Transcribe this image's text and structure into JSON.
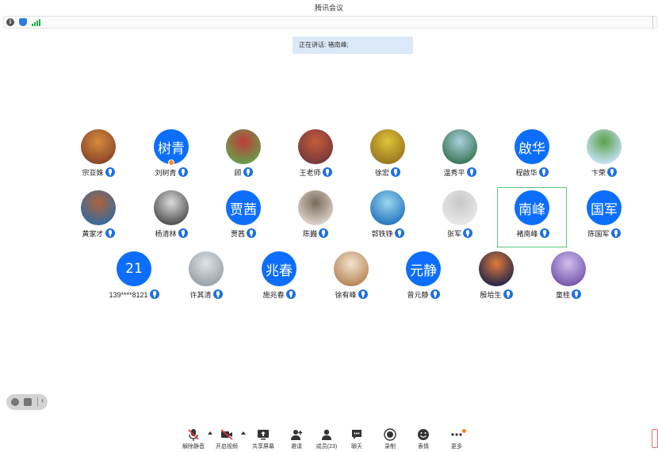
{
  "window": {
    "title": "腾讯会议"
  },
  "speaking": {
    "text": "正在讲话: 褚南峰;"
  },
  "participants": [
    {
      "name": "宗亚姝",
      "avatar_colors": [
        "#8b4a2b",
        "#d98a3a"
      ]
    },
    {
      "name": "刘树青",
      "avatar_text": "树青",
      "host": true
    },
    {
      "name": "顾",
      "avatar_colors": [
        "#6a9a4a",
        "#c33b3b"
      ]
    },
    {
      "name": "王老师",
      "avatar_colors": [
        "#7a3a3a",
        "#c45c3a"
      ]
    },
    {
      "name": "徐宏",
      "avatar_colors": [
        "#9b7a1f",
        "#e0c23a"
      ]
    },
    {
      "name": "温秀平",
      "avatar_colors": [
        "#3e7a5a",
        "#aad0e0"
      ]
    },
    {
      "name": "程啟华",
      "avatar_text": "啟华"
    },
    {
      "name": "卞荣",
      "avatar_colors": [
        "#bfe0ef",
        "#5aa04a"
      ]
    },
    {
      "name": "黄家才",
      "avatar_colors": [
        "#3a6a9a",
        "#b0623a"
      ]
    },
    {
      "name": "杨清林",
      "avatar_colors": [
        "#555555",
        "#dddddd"
      ]
    },
    {
      "name": "贾茜",
      "avatar_text": "贾茜"
    },
    {
      "name": "陈巍",
      "avatar_colors": [
        "#d8cfc6",
        "#7a6a5a"
      ]
    },
    {
      "name": "郭铁铮",
      "avatar_colors": [
        "#2a7ac0",
        "#9ed6f0"
      ]
    },
    {
      "name": "张军",
      "avatar_colors": [
        "#e6e6e6",
        "#c8c8c8"
      ]
    },
    {
      "name": "褚南峰",
      "avatar_text": "南峰",
      "highlight": true
    },
    {
      "name": "陈国军",
      "avatar_text": "国军"
    },
    {
      "name": "139****8121",
      "avatar_text": "21"
    },
    {
      "name": "许其清",
      "avatar_colors": [
        "#9aa3ab",
        "#dfe4e8"
      ]
    },
    {
      "name": "施兆春",
      "avatar_text": "兆春"
    },
    {
      "name": "徐有峰",
      "avatar_colors": [
        "#b98a5a",
        "#f0e4d0"
      ]
    },
    {
      "name": "曾元静",
      "avatar_text": "元静"
    },
    {
      "name": "殷垥生",
      "avatar_colors": [
        "#2a2a4a",
        "#e07a3a"
      ]
    },
    {
      "name": "童桂",
      "avatar_colors": [
        "#7a5ab0",
        "#d0c0ec"
      ]
    }
  ],
  "toolbar": {
    "unmute": "解除静音",
    "start_video": "开启视频",
    "share_screen": "共享屏幕",
    "invite": "邀请",
    "members": "成员(23)",
    "chat": "聊天",
    "record": "录制",
    "reactions": "表情",
    "more": "更多"
  },
  "colors": {
    "accent": "#0d6efd",
    "highlight_border": "#5cc37b",
    "speaking_bg": "#dbe8f8"
  }
}
